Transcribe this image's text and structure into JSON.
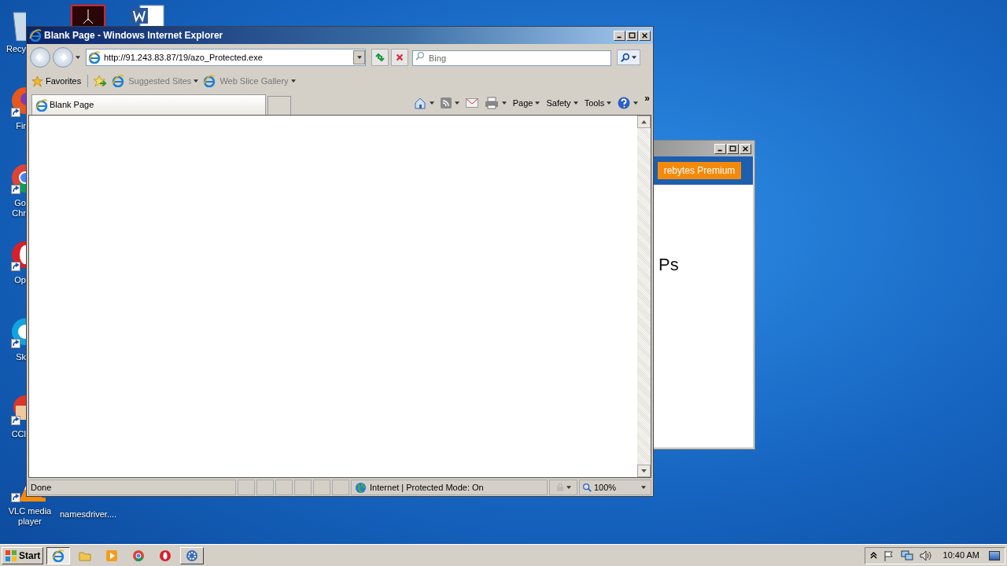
{
  "desktop": {
    "left_icons": [
      {
        "kind": "recycle",
        "label": "Recy"
      },
      {
        "kind": "firefox",
        "label": "Fir"
      },
      {
        "kind": "chrome",
        "label": "Go\nChr"
      },
      {
        "kind": "opera",
        "label": "Op"
      },
      {
        "kind": "skype",
        "label": "Sk"
      },
      {
        "kind": "ccleaner",
        "label": "CCl"
      },
      {
        "kind": "vlc",
        "label": "VLC media player"
      }
    ],
    "top_icons": [
      {
        "kind": "acrobat"
      },
      {
        "kind": "word"
      }
    ],
    "file_icon": {
      "label": "namesdriver...."
    }
  },
  "background_window": {
    "button": "rebytes Premium",
    "heading": "Ps"
  },
  "ie_window": {
    "title": "Blank Page - Windows Internet Explorer",
    "address": "http://91.243.83.87/19/azo_Protected.exe",
    "search": {
      "placeholder": "Bing"
    },
    "favorites_bar": [
      {
        "kind": "favorites",
        "label": "Favorites"
      },
      {
        "kind": "add"
      },
      {
        "kind": "link",
        "label": "Suggested Sites"
      },
      {
        "kind": "link",
        "label": "Web Slice Gallery"
      }
    ],
    "tab": {
      "label": "Blank Page"
    },
    "commands": [
      {
        "kind": "home"
      },
      {
        "kind": "feed"
      },
      {
        "kind": "mail"
      },
      {
        "kind": "print"
      },
      {
        "kind": "menu",
        "label": "Page"
      },
      {
        "kind": "menu",
        "label": "Safety"
      },
      {
        "kind": "menu",
        "label": "Tools"
      },
      {
        "kind": "help"
      },
      {
        "kind": "more",
        "label": "»"
      }
    ],
    "status": {
      "text": "Done",
      "zone": "Internet | Protected Mode: On",
      "zoom": "100%"
    }
  },
  "taskbar": {
    "start": "Start",
    "items": [
      {
        "kind": "ie",
        "selected": true
      },
      {
        "kind": "folder",
        "selected": false
      },
      {
        "kind": "media",
        "selected": false
      },
      {
        "kind": "chrome",
        "selected": false
      },
      {
        "kind": "opera",
        "selected": false
      },
      {
        "kind": "app",
        "selected": false
      }
    ],
    "clock": "10:40 AM"
  }
}
